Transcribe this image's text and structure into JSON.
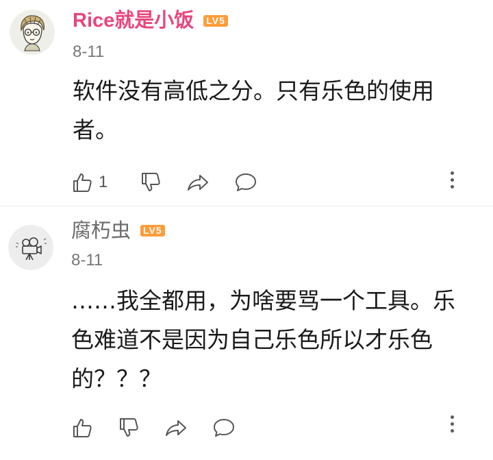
{
  "comments": [
    {
      "username": "Rice就是小饭",
      "level_badge": "LV5",
      "date": "8-11",
      "text": "软件没有高低之分。只有乐色的使用者。",
      "actions": {
        "like_icon": "thumbs-up-icon",
        "like_count": "1",
        "dislike_icon": "thumbs-down-icon",
        "share_icon": "share-arrow-icon",
        "reply_icon": "chat-bubble-icon",
        "more_icon": "vertical-ellipsis-icon"
      },
      "avatar_icon": "cartoon-person-avatar",
      "username_color": "#e8467c"
    },
    {
      "username": "腐朽虫",
      "level_badge": "LV5",
      "date": "8-11",
      "text": "……我全都用，为啥要骂一个工具。乐色难道不是因为自己乐色所以才乐色的？？？",
      "actions": {
        "like_icon": "thumbs-up-icon",
        "like_count": "",
        "dislike_icon": "thumbs-down-icon",
        "share_icon": "share-arrow-icon",
        "reply_icon": "chat-bubble-icon",
        "more_icon": "vertical-ellipsis-icon"
      },
      "avatar_icon": "camera-avatar",
      "username_color": "#6a6a6a"
    }
  ],
  "colors": {
    "level_badge": "#ff9c3a",
    "icon": "#555555",
    "date": "#777777"
  }
}
